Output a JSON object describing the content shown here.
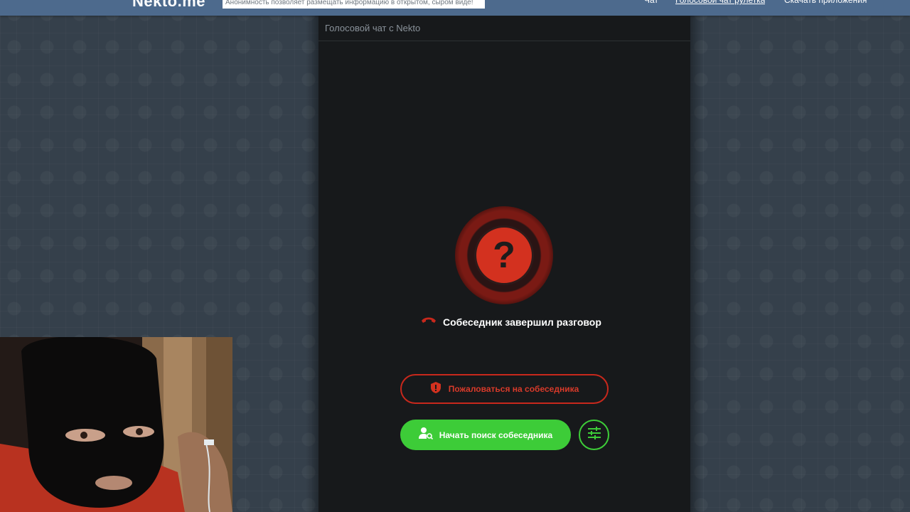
{
  "header": {
    "logo": "Nekto.me",
    "tagline": "Анонимность позволяет размещать информацию в открытом, сыром виде!",
    "nav": [
      {
        "label": "Чат"
      },
      {
        "label": "Голосовой чат рулетка"
      },
      {
        "label": "Скачать приложения"
      }
    ]
  },
  "panel": {
    "title": "Голосовой чат с Nekto",
    "avatar_glyph": "?",
    "status_text": "Собеседник завершил разговор",
    "report_label": "Пожаловаться на собеседника",
    "search_label": "Начать поиск собеседника"
  },
  "icons": {
    "status": "hangup-phone-icon",
    "report": "shield-alert-icon",
    "search": "user-search-icon",
    "filter": "sliders-icon"
  },
  "colors": {
    "topbar": "#4d6a8d",
    "panel_bg": "#17191b",
    "danger": "#d3311f",
    "success": "#3dcc38"
  }
}
